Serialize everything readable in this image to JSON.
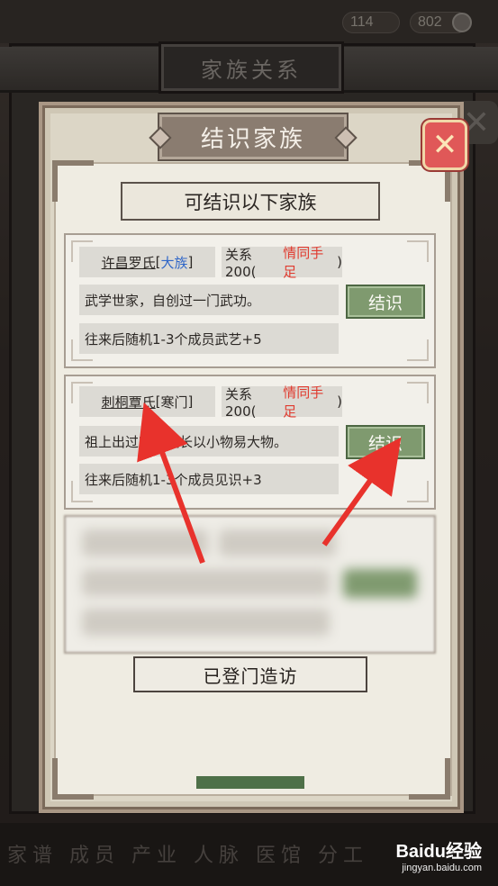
{
  "top_bar": {
    "currency_a": "114",
    "currency_b": "802"
  },
  "outer": {
    "title": "家族关系"
  },
  "dialog": {
    "title": "结识家族",
    "close_icon": "close-x-icon",
    "header": "可结识以下家族",
    "families": [
      {
        "name": "许昌罗氏",
        "type_open": "[",
        "type": "大族",
        "type_close": "]",
        "relation_prefix": "关系200(",
        "relation_status": "情同手足",
        "relation_suffix": ")",
        "description": "武学世家，自创过一门武功。",
        "join_label": "结识",
        "bonus": "往来后随机1-3个成员武艺+5"
      },
      {
        "name": "刺桐覃氏",
        "type_open": "[",
        "type": "寒门",
        "type_close": "]",
        "relation_prefix": "关系200(",
        "relation_status": "情同手足",
        "relation_suffix": ")",
        "description": "祖上出过官，擅长以小物易大物。",
        "join_label": "结识",
        "bonus": "往来后随机1-3个成员见识+3"
      }
    ],
    "visited_label": "已登门造访"
  },
  "bottom_nav": {
    "labels": "家谱 成员 产业 人脉 医馆 分工"
  },
  "watermark": {
    "brand": "Baidu经验",
    "url": "jingyan.baidu.com"
  },
  "colors": {
    "accent_red": "#e03a2e",
    "type_blue": "#2f66c8",
    "join_green": "#7f9a6f",
    "close_red": "#e05858",
    "arrow_red": "#e8322c"
  }
}
